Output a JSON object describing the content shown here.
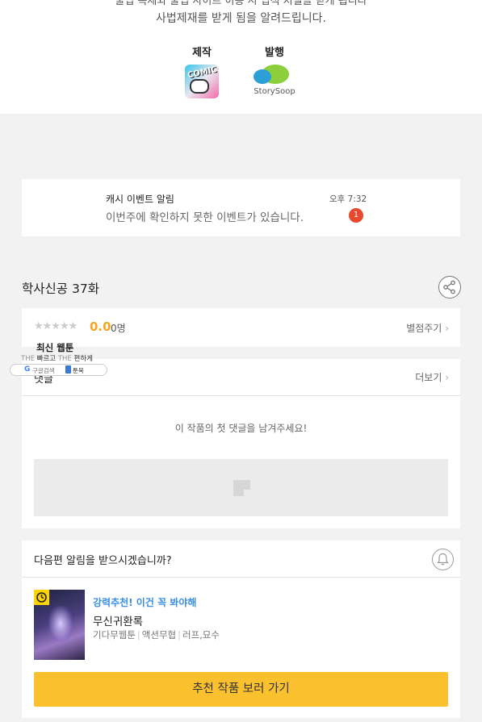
{
  "top": {
    "notice_line1_cut": "불법 복제와 불법 사이트 이용 시 법적 처벌을 받게 됩니다",
    "notice_line2": "사법제재를 받게 됨을 알려드립니다.",
    "producer_label": "제작",
    "producer_logo_text": "COMICS",
    "publisher_label": "발행",
    "publisher_logo_text": "StorySoop"
  },
  "alert": {
    "title": "캐시 이벤트 알림",
    "body": "이번주에 확인하지 못한 이벤트가 있습니다.",
    "time": "오후 7:32",
    "badge": "1"
  },
  "episode": {
    "title": "학사신공 37화"
  },
  "rating": {
    "stars": "★★★★★",
    "score": "0.0",
    "count": "0명",
    "rate_link": "별점주기"
  },
  "comments": {
    "title": "댓글",
    "more": "더보기",
    "empty": "이 작품의 첫 댓글을 남겨주세요!"
  },
  "overlay": {
    "title": "최신 웹툰",
    "sub_the1": "THE",
    "sub_fast": "빠르고",
    "sub_the2": "THE",
    "sub_comfy": "편하게",
    "bar_google": "G",
    "bar_label1": "구글검색",
    "bar_label2": "툰북"
  },
  "next": {
    "question": "다음편 알림을 받으시겠습니까?",
    "rec_tag": "강력추천! 이건 꼭 봐야해",
    "rec_title": "무신귀환록",
    "meta": [
      "기다무웹툰",
      "액션무협",
      "러프,묘수"
    ],
    "cta": "추천 작품 보러 가기"
  },
  "colors": {
    "accent_yellow": "#fbc02d",
    "badge_red": "#e8482d",
    "score_orange": "#f5a623",
    "rec_blue": "#3a8ee6"
  }
}
